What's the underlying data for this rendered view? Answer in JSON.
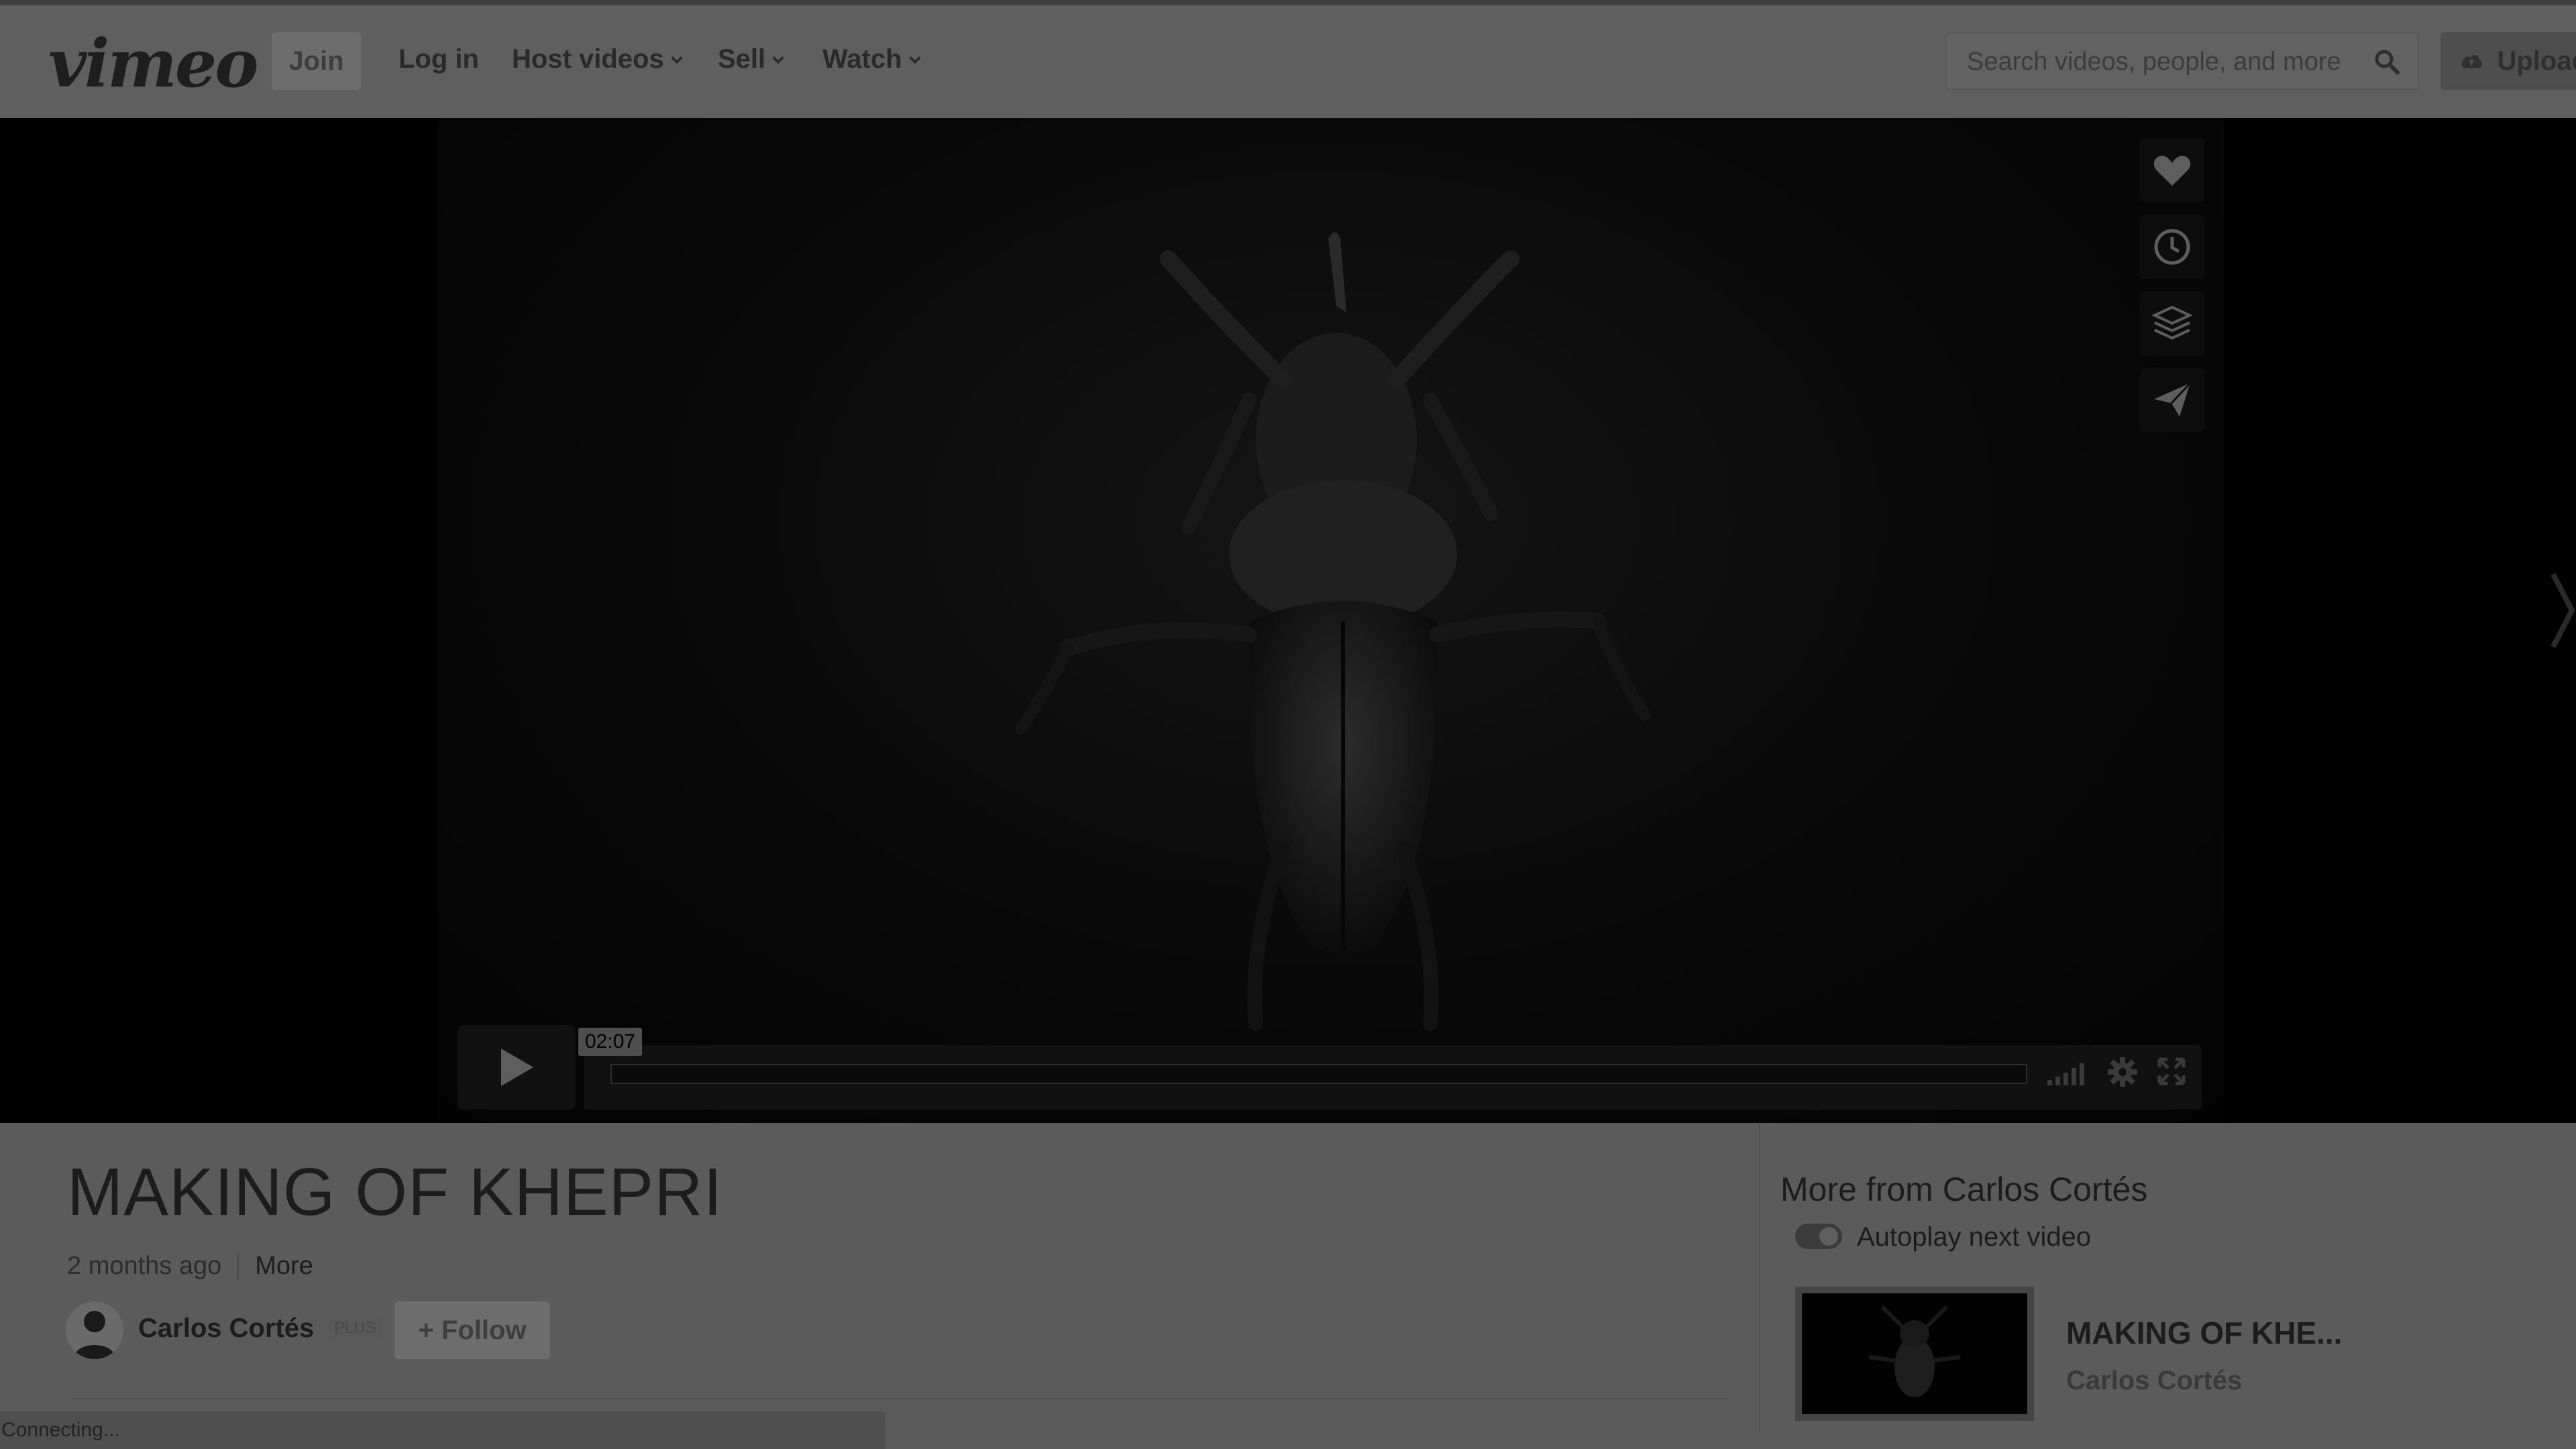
{
  "header": {
    "logo": "vimeo",
    "join_label": "Join",
    "login_label": "Log in",
    "nav": [
      {
        "label": "Host videos"
      },
      {
        "label": "Sell"
      },
      {
        "label": "Watch"
      }
    ],
    "search_placeholder": "Search videos, people, and more",
    "upload_label": "Upload"
  },
  "player": {
    "time_tooltip": "02:07",
    "progress_fraction": 0,
    "side_actions": [
      "heart-icon",
      "clock-icon",
      "layers-icon",
      "send-icon"
    ]
  },
  "video": {
    "title": "MAKING OF KHEPRI",
    "age": "2 months ago",
    "more_label": "More",
    "author": "Carlos Cortés",
    "author_badge": "PLUS",
    "follow_label": "+ Follow"
  },
  "sidebar": {
    "heading": "More from Carlos Cortés",
    "autoplay_label": "Autoplay next video",
    "autoplay_on": true,
    "related": [
      {
        "title": "MAKING OF KHE...",
        "author": "Carlos Cortés"
      }
    ]
  },
  "status_bar": "Connecting..."
}
